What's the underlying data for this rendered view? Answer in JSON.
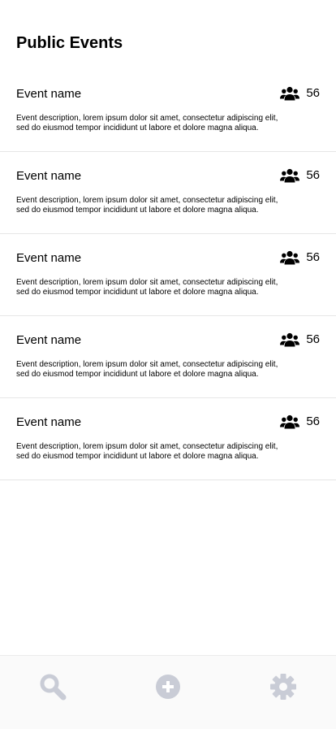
{
  "page": {
    "title": "Public Events"
  },
  "events": [
    {
      "name": "Event name",
      "count": "56",
      "description": "Event description, lorem ipsum dolor sit amet, consectetur adipiscing elit, sed do eiusmod tempor incididunt ut labore et dolore magna aliqua."
    },
    {
      "name": "Event name",
      "count": "56",
      "description": "Event description, lorem ipsum dolor sit amet, consectetur adipiscing elit, sed do eiusmod tempor incididunt ut labore et dolore magna aliqua."
    },
    {
      "name": "Event name",
      "count": "56",
      "description": "Event description, lorem ipsum dolor sit amet, consectetur adipiscing elit, sed do eiusmod tempor incididunt ut labore et dolore magna aliqua."
    },
    {
      "name": "Event name",
      "count": "56",
      "description": "Event description, lorem ipsum dolor sit amet, consectetur adipiscing elit, sed do eiusmod tempor incididunt ut labore et dolore magna aliqua."
    },
    {
      "name": "Event name",
      "count": "56",
      "description": "Event description, lorem ipsum dolor sit amet, consectetur adipiscing elit, sed do eiusmod tempor incididunt ut labore et dolore magna aliqua."
    }
  ],
  "icons": {
    "attendees": "people-icon",
    "nav_search": "search-icon",
    "nav_add": "add-circle-icon",
    "nav_settings": "gear-icon"
  },
  "colors": {
    "text": "#000000",
    "nav_icon": "#c9ccd6",
    "nav_background": "#fafafa",
    "divider": "#e6e6e6"
  }
}
